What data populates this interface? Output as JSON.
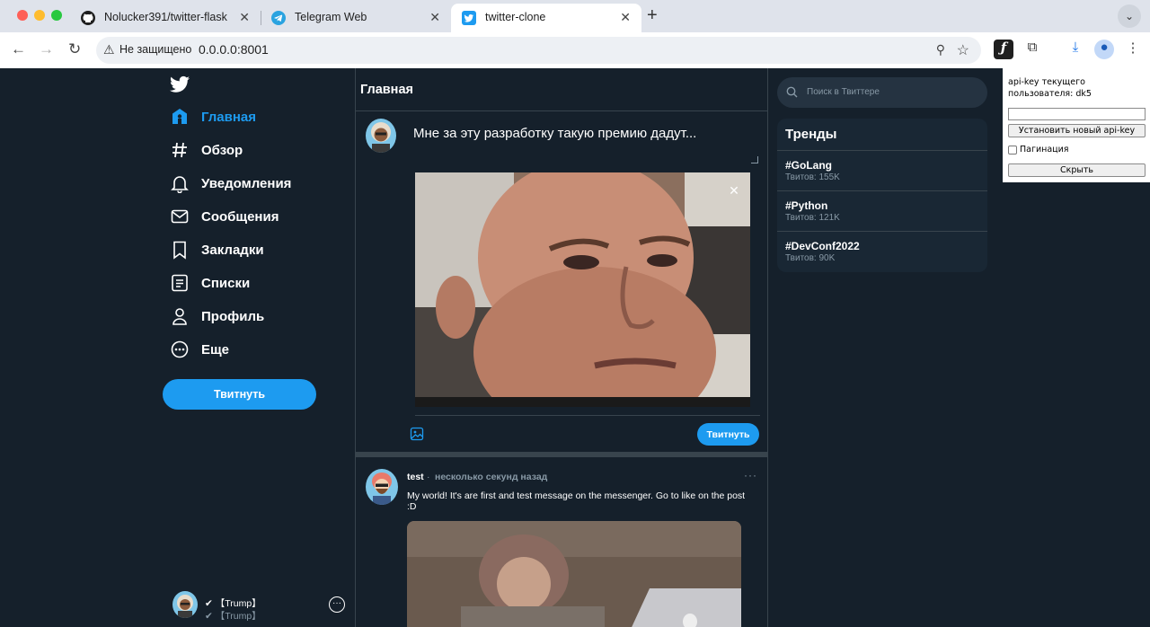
{
  "browser": {
    "tabs": [
      {
        "title": "Nolucker391/twitter-flask",
        "icon": "github-icon"
      },
      {
        "title": "Telegram Web",
        "icon": "telegram-icon"
      },
      {
        "title": "twitter-clone",
        "icon": "twitter-icon",
        "active": true
      }
    ],
    "security_label": "Не защищено",
    "url": "0.0.0.0:8001"
  },
  "sidebar": {
    "items": [
      {
        "label": "Главная",
        "icon": "home-icon",
        "active": true
      },
      {
        "label": "Обзор",
        "icon": "hashtag-icon"
      },
      {
        "label": "Уведомления",
        "icon": "bell-icon"
      },
      {
        "label": "Сообщения",
        "icon": "envelope-icon"
      },
      {
        "label": "Закладки",
        "icon": "bookmark-icon"
      },
      {
        "label": "Списки",
        "icon": "list-icon"
      },
      {
        "label": "Профиль",
        "icon": "user-icon"
      },
      {
        "label": "Еще",
        "icon": "more-icon"
      }
    ],
    "tweet_button": "Твитнуть",
    "user": {
      "name": "✔ 【Trump】",
      "handle": "✔ 【Trump】"
    }
  },
  "main": {
    "title": "Главная",
    "composer": {
      "text": "Мне за эту разработку такую премию дадут...",
      "close_symbol": "✕",
      "tweet_button": "Твитнуть"
    },
    "post": {
      "author": "test",
      "separator": "·",
      "time": "несколько секунд назад",
      "more": "···",
      "text": "My world! It's are first and test message on the messenger. Go to like on the post :D"
    }
  },
  "right": {
    "search_placeholder": "Поиск в Твиттере",
    "trends_title": "Тренды",
    "trends": [
      {
        "tag": "#GoLang",
        "count": "Твитов: 155K"
      },
      {
        "tag": "#Python",
        "count": "Твитов: 121K"
      },
      {
        "tag": "#DevConf2022",
        "count": "Твитов: 90K"
      }
    ]
  },
  "api_panel": {
    "label": "api-key текущего пользователя: dk5",
    "input_value": "",
    "set_button": "Установить новый api-key",
    "pagination_label": "Пагинация",
    "hide_button": "Скрыть"
  },
  "colors": {
    "background": "#15202b",
    "accent": "#1d9bf0",
    "panel": "#192734",
    "border": "#38444d",
    "muted_text": "#8899a6"
  }
}
